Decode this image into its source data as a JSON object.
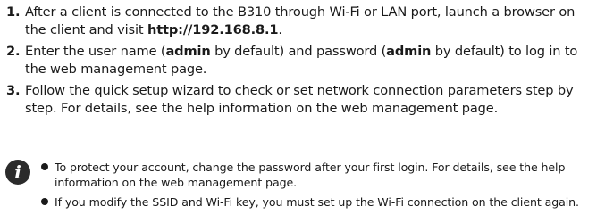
{
  "steps": [
    {
      "number": "1.",
      "parts": [
        {
          "text": "After a client is connected to the B310 through Wi-Fi or LAN port, launch a browser on the client and visit ",
          "bold": false
        },
        {
          "text": "http://192.168.8.1",
          "bold": true
        },
        {
          "text": ".",
          "bold": false
        }
      ]
    },
    {
      "number": "2.",
      "parts": [
        {
          "text": "Enter the user name (",
          "bold": false
        },
        {
          "text": "admin",
          "bold": true
        },
        {
          "text": " by default) and password (",
          "bold": false
        },
        {
          "text": "admin",
          "bold": true
        },
        {
          "text": " by default) to log in to the web management page.",
          "bold": false
        }
      ]
    },
    {
      "number": "3.",
      "parts": [
        {
          "text": "Follow the quick setup wizard to check or set network connection parameters step by step. For details, see the help information on the web management page.",
          "bold": false
        }
      ]
    }
  ],
  "note": {
    "icon": "info-icon",
    "icon_glyph": "i",
    "bullets": [
      "To protect your account, change the password after your first login. For details, see the help information on the web management page.",
      "If you modify the SSID and Wi-Fi key, you must set up the Wi-Fi connection on the client again."
    ]
  }
}
